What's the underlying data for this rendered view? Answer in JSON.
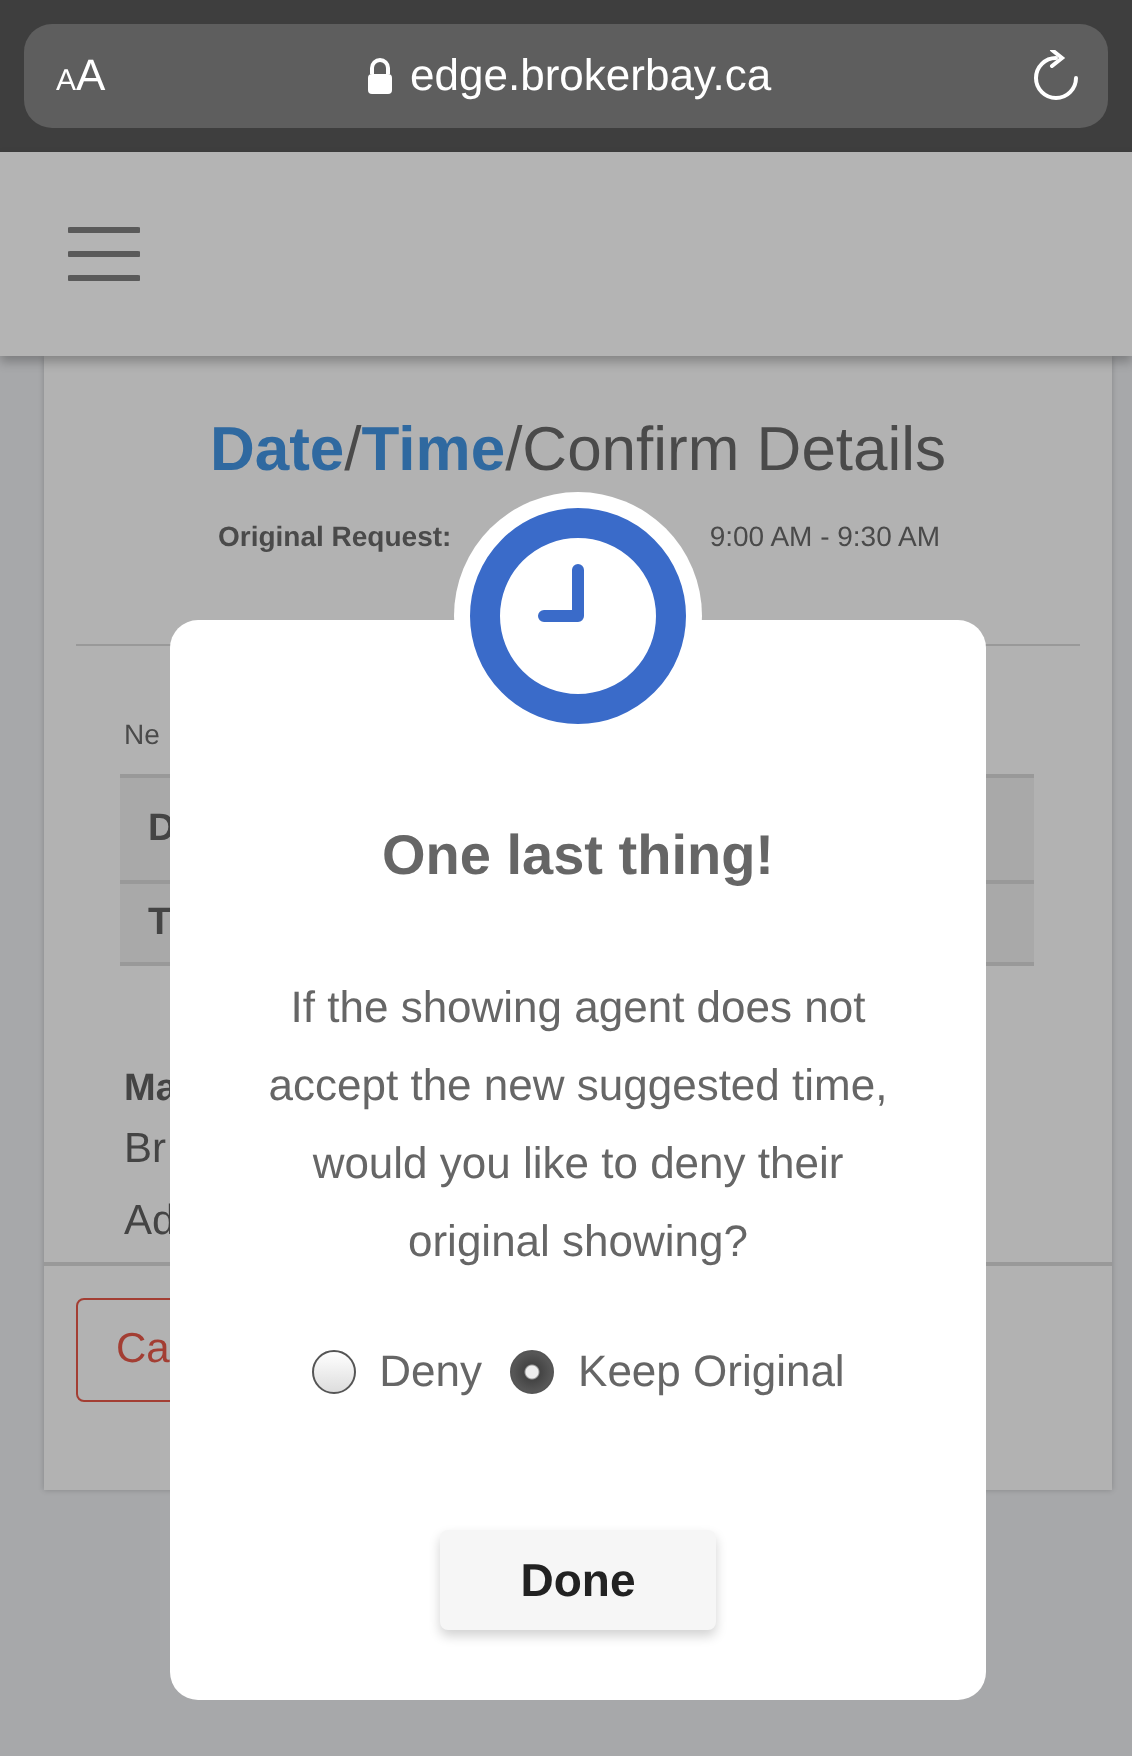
{
  "browser": {
    "text_size": [
      "A",
      "A"
    ],
    "url": "edge.brokerbay.ca"
  },
  "page": {
    "heading": [
      {
        "text": "Date",
        "kind": "step"
      },
      {
        "text": "/",
        "kind": "sep"
      },
      {
        "text": "Time",
        "kind": "step"
      },
      {
        "text": "/Confirm Details",
        "kind": "rest"
      }
    ],
    "original_request": {
      "label": "Original Request:",
      "value": "9:00 AM - 9:30 AM"
    },
    "new_label": "Ne",
    "table_rows": [
      "D",
      "T"
    ],
    "section_title": "Ma",
    "lines": [
      "Br",
      "Ad"
    ],
    "cancel_button": "Ca"
  },
  "modal": {
    "title": "One last thing!",
    "message": "If the showing agent does not accept the new suggested time, would you like to deny their original showing?",
    "options": [
      {
        "label": "Deny",
        "selected": false
      },
      {
        "label": "Keep Original",
        "selected": true
      }
    ],
    "button": "Done"
  }
}
